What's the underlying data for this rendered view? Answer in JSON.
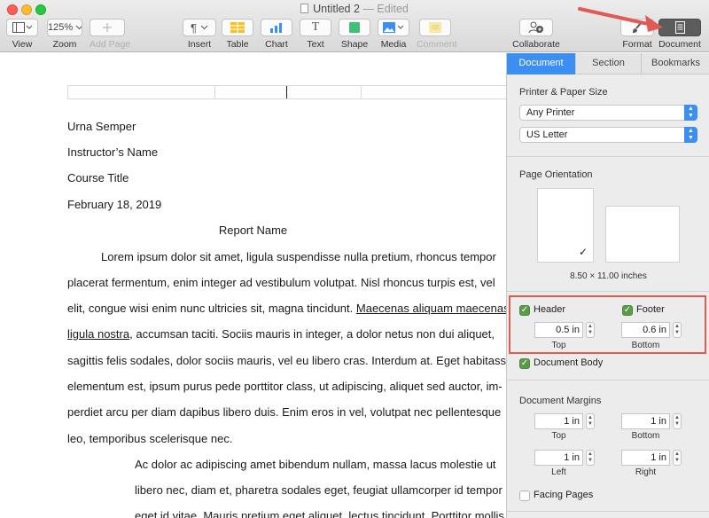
{
  "window": {
    "title": "Untitled 2",
    "separator": "—",
    "status": "Edited"
  },
  "toolbar": {
    "view": {
      "label": "View",
      "icon": "sidebar-icon"
    },
    "zoom": {
      "label": "Zoom",
      "value": "125%"
    },
    "add_page": {
      "label": "Add Page",
      "icon": "plus-icon"
    },
    "insert": {
      "label": "Insert",
      "icon": "paragraph-icon",
      "glyph": "¶"
    },
    "table": {
      "label": "Table",
      "icon": "table-icon"
    },
    "chart": {
      "label": "Chart",
      "icon": "chart-icon"
    },
    "text": {
      "label": "Text",
      "icon": "text-icon",
      "glyph": "T"
    },
    "shape": {
      "label": "Shape",
      "icon": "shape-icon"
    },
    "media": {
      "label": "Media",
      "icon": "media-icon"
    },
    "comment": {
      "label": "Comment",
      "icon": "comment-icon"
    },
    "collaborate": {
      "label": "Collaborate",
      "icon": "collaborate-icon"
    },
    "format": {
      "label": "Format",
      "icon": "paintbrush-icon"
    },
    "document": {
      "label": "Document",
      "icon": "document-icon"
    }
  },
  "document": {
    "lines": [
      "Urna Semper",
      "Instructor’s Name",
      "Course Title",
      "February 18, 2019"
    ],
    "report_title": "Report Name",
    "body": [
      {
        "text": "Lorem ipsum dolor sit amet, ligula suspendisse nulla pretium, rhoncus tempor"
      },
      {
        "text": "placerat fermentum, enim integer ad vestibulum volutpat. Nisl rhoncus turpis est, vel"
      },
      {
        "text": "elit, congue wisi enim nunc ultricies sit, magna tincidunt. ",
        "underlined": "Maecenas aliquam maecenas"
      },
      {
        "underlined": "ligula nostra",
        "text": ", accumsan taciti. Sociis mauris in integer, a dolor netus non dui aliquet,"
      },
      {
        "text": "sagittis felis sodales, dolor sociis mauris, vel eu libero cras. Interdum at. Eget habitasse"
      },
      {
        "text": "elementum est, ipsum purus pede porttitor class, ut adipiscing, aliquet sed auctor, im-"
      },
      {
        "text": "perdiet arcu per diam dapibus libero duis. Enim eros in vel, volutpat nec pellentesque"
      },
      {
        "text": "leo, temporibus scelerisque nec."
      }
    ],
    "quote": [
      "Ac dolor ac adipiscing amet bibendum nullam, massa lacus molestie ut",
      "libero nec, diam et, pharetra sodales eget, feugiat ullamcorper id tempor",
      "eget id vitae. Mauris pretium eget aliquet, lectus tincidunt. Porttitor mollis"
    ]
  },
  "inspector": {
    "tabs": [
      {
        "label": "Document",
        "active": true
      },
      {
        "label": "Section",
        "active": false
      },
      {
        "label": "Bookmarks",
        "active": false
      }
    ],
    "printer_section": {
      "title": "Printer & Paper Size",
      "printer": "Any Printer",
      "paper": "US Letter"
    },
    "orientation": {
      "title": "Page Orientation",
      "selected": "portrait",
      "size_label": "8.50 × 11.00 inches",
      "check": "✓"
    },
    "header": {
      "label": "Header",
      "checked": true,
      "value": "0.5 in",
      "caption": "Top"
    },
    "footer": {
      "label": "Footer",
      "checked": true,
      "value": "0.6 in",
      "caption": "Bottom"
    },
    "document_body": {
      "label": "Document Body",
      "checked": true
    },
    "margins": {
      "title": "Document Margins",
      "top": {
        "value": "1 in",
        "caption": "Top"
      },
      "bottom": {
        "value": "1 in",
        "caption": "Bottom"
      },
      "left": {
        "value": "1 in",
        "caption": "Left"
      },
      "right": {
        "value": "1 in",
        "caption": "Right"
      }
    },
    "facing_pages": {
      "label": "Facing Pages",
      "checked": false
    }
  },
  "colors": {
    "accent": "#3b8ff3",
    "checkbox": "#5a9a49",
    "highlight_box": "#e05b55",
    "arrow": "#e05b55"
  }
}
